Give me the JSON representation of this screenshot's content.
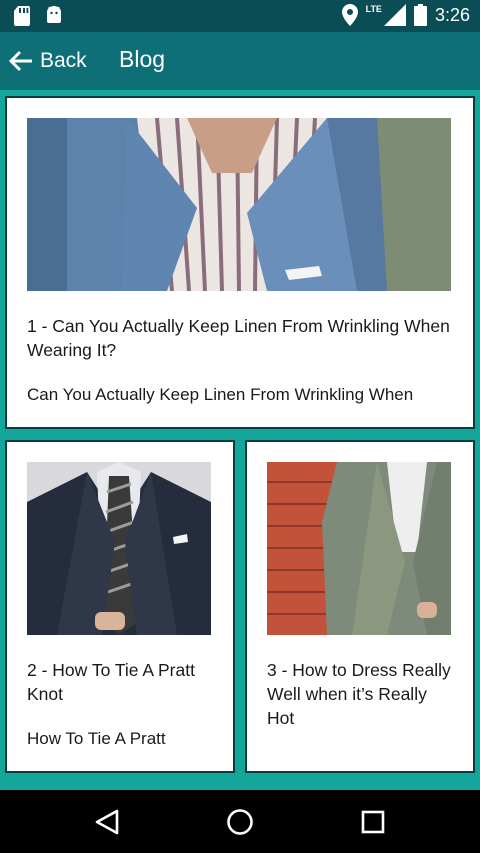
{
  "status_bar": {
    "time": "3:26",
    "network_label": "LTE",
    "icons": [
      "sd-card-icon",
      "android-icon",
      "location-icon",
      "lte-signal-icon",
      "battery-icon"
    ]
  },
  "app_bar": {
    "back_label": "Back",
    "title": "Blog"
  },
  "posts": [
    {
      "title": "1 - Can You Actually Keep Linen From Wrinkling When Wearing It?",
      "excerpt": "Can You Actually Keep Linen From Wrinkling When",
      "image": "blue-checked-blazer-striped-shirt-photo"
    },
    {
      "title": "2 - How To Tie A Pratt Knot",
      "excerpt": "How To Tie A Pratt",
      "image": "navy-suit-striped-tie-photo"
    },
    {
      "title": "3 - How to Dress Really Well when it’s Really Hot",
      "excerpt": "",
      "image": "grey-blazer-brick-wall-photo"
    }
  ],
  "nav_bar": {
    "buttons": [
      "back-triangle-icon",
      "home-circle-icon",
      "recents-square-icon"
    ]
  },
  "colors": {
    "status_bar": "#0a4d54",
    "app_bar": "#0e6f77",
    "content_background": "#14a69b",
    "card_border": "#0b3b3f",
    "nav_bar": "#000000"
  }
}
